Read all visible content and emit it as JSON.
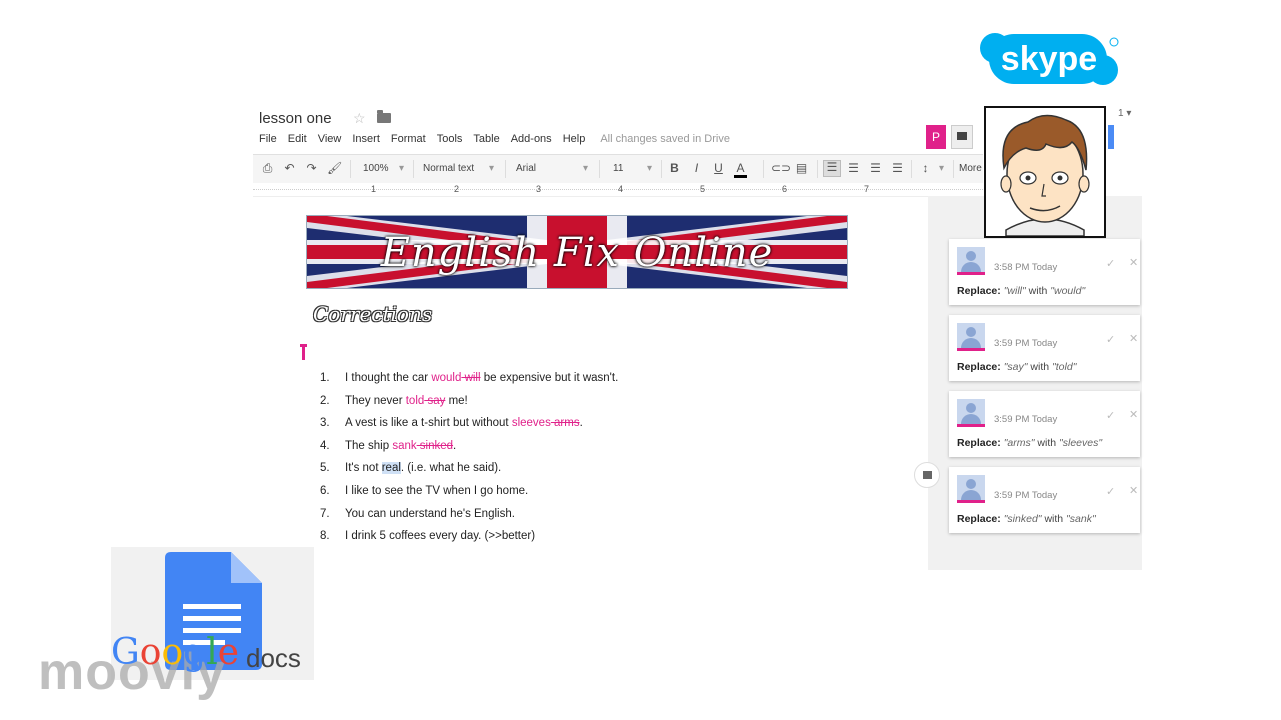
{
  "doc": {
    "title": "lesson one",
    "saved_status": "All changes saved in Drive",
    "menu": [
      "File",
      "Edit",
      "View",
      "Insert",
      "Format",
      "Tools",
      "Table",
      "Add-ons",
      "Help"
    ],
    "user_initial": "P"
  },
  "toolbar": {
    "zoom": "100%",
    "style": "Normal text",
    "font": "Arial",
    "size": "11",
    "more": "More"
  },
  "ruler": [
    "1",
    "2",
    "3",
    "4",
    "5",
    "6",
    "7"
  ],
  "banner_text": "English Fix Online",
  "heading": "Corrections",
  "list": [
    {
      "num": "1.",
      "parts": [
        {
          "t": "I thought the car ",
          "s": "n"
        },
        {
          "t": "would",
          "s": "ins"
        },
        {
          "t": " will",
          "s": "del"
        },
        {
          "t": " be expensive but it wasn't.",
          "s": "n"
        }
      ]
    },
    {
      "num": "2.",
      "parts": [
        {
          "t": "They never ",
          "s": "n"
        },
        {
          "t": "told",
          "s": "ins"
        },
        {
          "t": " say",
          "s": "del"
        },
        {
          "t": " me!",
          "s": "n"
        }
      ]
    },
    {
      "num": "3.",
      "parts": [
        {
          "t": "A vest is like a t-shirt but without ",
          "s": "n"
        },
        {
          "t": "sleeves",
          "s": "ins"
        },
        {
          "t": " arms",
          "s": "del"
        },
        {
          "t": ".",
          "s": "n"
        }
      ]
    },
    {
      "num": "4.",
      "parts": [
        {
          "t": "The ship ",
          "s": "n"
        },
        {
          "t": "sank",
          "s": "ins"
        },
        {
          "t": " sinked",
          "s": "del"
        },
        {
          "t": ".",
          "s": "n"
        }
      ]
    },
    {
      "num": "5.",
      "parts": [
        {
          "t": "It's not ",
          "s": "n"
        },
        {
          "t": "real",
          "s": "hl"
        },
        {
          "t": ".  (i.e. what he said).",
          "s": "n"
        }
      ]
    },
    {
      "num": "6.",
      "parts": [
        {
          "t": "I like to see the TV when I go home.",
          "s": "n"
        }
      ]
    },
    {
      "num": "7.",
      "parts": [
        {
          "t": "You can understand he's English.",
          "s": "n"
        }
      ]
    },
    {
      "num": "8.",
      "parts": [
        {
          "t": "I drink 5 coffees every day.  (>>better)",
          "s": "n"
        }
      ]
    }
  ],
  "comments": [
    {
      "time": "3:58 PM Today",
      "label": "Replace:",
      "from": "\"will\"",
      "with": "with",
      "to": "\"would\""
    },
    {
      "time": "3:59 PM Today",
      "label": "Replace:",
      "from": "\"say\"",
      "with": "with",
      "to": "\"told\""
    },
    {
      "time": "3:59 PM Today",
      "label": "Replace:",
      "from": "\"arms\"",
      "with": "with",
      "to": "\"sleeves\""
    },
    {
      "time": "3:59 PM Today",
      "label": "Replace:",
      "from": "\"sinked\"",
      "with": "with",
      "to": "\"sank\""
    }
  ],
  "branding": {
    "skype": "skype",
    "google": "Google",
    "docs": "docs",
    "moovly": "moovly"
  },
  "colors": {
    "accent_pink": "#e0218a",
    "skype_blue": "#00aff0",
    "docs_blue": "#4285f4"
  }
}
